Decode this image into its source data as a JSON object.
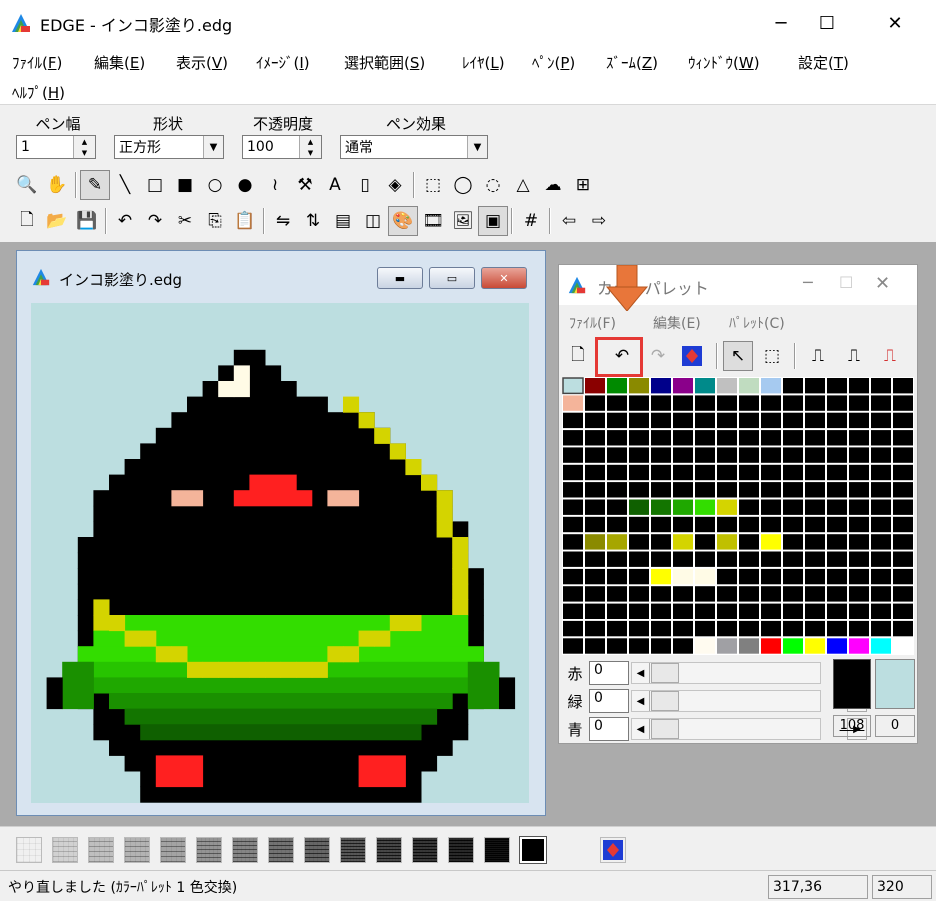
{
  "window": {
    "title": "EDGE - インコ影塗り.edg",
    "minimize": "─",
    "maximize": "☐",
    "close": "✕"
  },
  "menu": [
    {
      "label": "ﾌｧｲﾙ(",
      "key": "F",
      "end": ")"
    },
    {
      "label": "編集(",
      "key": "E",
      "end": ")"
    },
    {
      "label": "表示(",
      "key": "V",
      "end": ")"
    },
    {
      "label": "ｲﾒｰｼﾞ(",
      "key": "I",
      "end": ")"
    },
    {
      "label": "選択範囲(",
      "key": "S",
      "end": ")"
    },
    {
      "label": "ﾚｲﾔ(",
      "key": "L",
      "end": ")"
    },
    {
      "label": "ﾍﾟﾝ(",
      "key": "P",
      "end": ")"
    },
    {
      "label": "ｽﾞｰﾑ(",
      "key": "Z",
      "end": ")"
    },
    {
      "label": "ｳｨﾝﾄﾞｳ(",
      "key": "W",
      "end": ")"
    },
    {
      "label": "設定(",
      "key": "T",
      "end": ")"
    },
    {
      "label": "ﾍﾙﾌﾟ(",
      "key": "H",
      "end": ")"
    }
  ],
  "pen": {
    "width_label": "ペン幅",
    "width_value": "1",
    "shape_label": "形状",
    "shape_value": "正方形",
    "opacity_label": "不透明度",
    "opacity_value": "100",
    "effect_label": "ペン効果",
    "effect_value": "通常"
  },
  "toolbar1": [
    {
      "name": "zoom-icon",
      "glyph": "🔍"
    },
    {
      "name": "hand-icon",
      "glyph": "✋"
    },
    {
      "sep": true
    },
    {
      "name": "pen-icon",
      "glyph": "✎",
      "selected": true
    },
    {
      "name": "line-icon",
      "glyph": "╲"
    },
    {
      "name": "rectangle-icon",
      "glyph": "□"
    },
    {
      "name": "filled-rectangle-icon",
      "glyph": "■"
    },
    {
      "name": "ellipse-icon",
      "glyph": "○"
    },
    {
      "name": "filled-ellipse-icon",
      "glyph": "●"
    },
    {
      "name": "curve-icon",
      "glyph": "≀"
    },
    {
      "name": "hammer-icon",
      "glyph": "⚒"
    },
    {
      "name": "text-icon",
      "glyph": "A"
    },
    {
      "name": "spray-icon",
      "glyph": "▯"
    },
    {
      "name": "fill-icon",
      "glyph": "◈"
    },
    {
      "sep": true
    },
    {
      "name": "rect-select-icon",
      "glyph": "⬚"
    },
    {
      "name": "ellipse-select-icon",
      "glyph": "◯"
    },
    {
      "name": "lasso-icon",
      "glyph": "◌"
    },
    {
      "name": "polygon-select-icon",
      "glyph": "△"
    },
    {
      "name": "magic-select-icon",
      "glyph": "☁"
    },
    {
      "name": "select-icon",
      "glyph": "⊞"
    }
  ],
  "toolbar2": [
    {
      "name": "new-file-icon",
      "glyph": "🗋"
    },
    {
      "name": "open-folder-icon",
      "glyph": "📂"
    },
    {
      "name": "save-icon",
      "glyph": "💾"
    },
    {
      "sep": true
    },
    {
      "name": "undo-icon",
      "glyph": "↶"
    },
    {
      "name": "redo-icon",
      "glyph": "↷"
    },
    {
      "name": "cut-icon",
      "glyph": "✂"
    },
    {
      "name": "copy-icon",
      "glyph": "⎘"
    },
    {
      "name": "paste-icon",
      "glyph": "📋"
    },
    {
      "sep": true
    },
    {
      "name": "flip-h-icon",
      "glyph": "⇋"
    },
    {
      "name": "flip-v-icon",
      "glyph": "⇅"
    },
    {
      "name": "grid-lines-icon",
      "glyph": "▤"
    },
    {
      "name": "layers-icon",
      "glyph": "◫"
    },
    {
      "name": "palette-icon",
      "glyph": "🎨",
      "selected": true
    },
    {
      "name": "film-icon",
      "glyph": "🎞"
    },
    {
      "name": "image-icon",
      "glyph": "🖼"
    },
    {
      "name": "frame-icon",
      "glyph": "▣",
      "selected": true
    },
    {
      "sep": true
    },
    {
      "name": "grid-icon",
      "glyph": "#"
    },
    {
      "sep": true
    },
    {
      "name": "arrow-left-icon",
      "glyph": "⇦"
    },
    {
      "name": "arrow-right-icon",
      "glyph": "⇨"
    }
  ],
  "canvas_window": {
    "title": "インコ影塗り.edg",
    "bg_color": "#bcdee0"
  },
  "palette_window": {
    "title": "カラーパレット",
    "menu": [
      "ﾌｧｲﾙ(F)",
      "編集(E)",
      "ﾊﾟﾚｯﾄ(C)"
    ],
    "channels": [
      {
        "label": "赤",
        "value": "0"
      },
      {
        "label": "緑",
        "value": "0"
      },
      {
        "label": "青",
        "value": "0"
      }
    ],
    "index": "108",
    "alpha": "0",
    "current_color": "#000000",
    "bg_color": "#bcdee0",
    "highlight_color": "#e53935",
    "arrow_color": "#e8763a"
  },
  "status": {
    "message": "やり直しました (ｶﾗｰﾊﾟﾚｯﾄ 1 色交換)",
    "coords": "317,36",
    "size": "320"
  }
}
